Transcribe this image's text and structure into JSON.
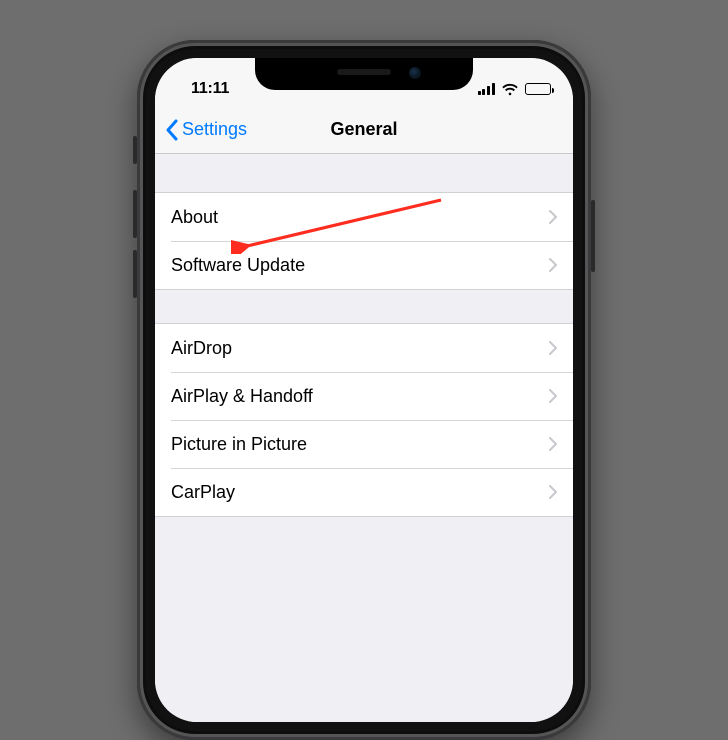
{
  "status": {
    "time": "11:11"
  },
  "nav": {
    "back_label": "Settings",
    "title": "General"
  },
  "groups": [
    {
      "items": [
        {
          "label": "About"
        },
        {
          "label": "Software Update"
        }
      ]
    },
    {
      "items": [
        {
          "label": "AirDrop"
        },
        {
          "label": "AirPlay & Handoff"
        },
        {
          "label": "Picture in Picture"
        },
        {
          "label": "CarPlay"
        }
      ]
    }
  ],
  "annotation": {
    "arrow_target": "About"
  }
}
